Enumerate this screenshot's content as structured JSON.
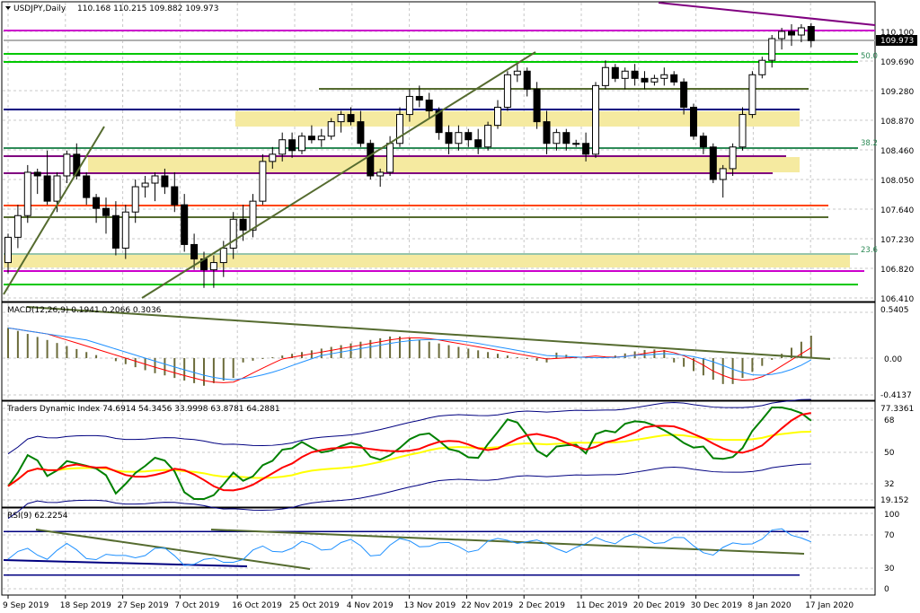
{
  "header": {
    "title": "USDJPY,Daily",
    "ohlc": "110.168 110.215 109.882 109.973"
  },
  "price_panel": {
    "current_price": "109.973",
    "y_ticks": [
      "110.100",
      "109.690",
      "109.280",
      "108.870",
      "108.460",
      "108.050",
      "107.640",
      "107.230",
      "106.820",
      "106.410"
    ],
    "fib_labels": [
      "50.0",
      "38.2",
      "23.6"
    ]
  },
  "macd_panel": {
    "label": "MACD(12,26,9) 0.1941 0.2066 0.3036",
    "y_ticks": [
      "0.5405",
      "0.00",
      "-0.4137"
    ]
  },
  "tdi_panel": {
    "label": "Traders Dynamic Index 74.6914 54.3456 33.9998 63.8781 64.2881",
    "y_ticks": [
      "77.3361",
      "68",
      "50",
      "32",
      "19.152"
    ]
  },
  "rsi_panel": {
    "label": "RSI(9) 62.2254",
    "y_ticks": [
      "100",
      "70",
      "30",
      "0"
    ]
  },
  "x_axis": {
    "labels": [
      "9 Sep 2019",
      "18 Sep 2019",
      "27 Sep 2019",
      "7 Oct 2019",
      "16 Oct 2019",
      "25 Oct 2019",
      "4 Nov 2019",
      "13 Nov 2019",
      "22 Nov 2019",
      "2 Dec 2019",
      "11 Dec 2019",
      "20 Dec 2019",
      "30 Dec 2019",
      "8 Jan 2020",
      "17 Jan 2020"
    ]
  },
  "colors": {
    "bull": "#ffffff",
    "bear": "#000000",
    "support_green": "#00c800",
    "magenta": "#cc00cc",
    "navy": "#000080",
    "purple": "#800080",
    "olive": "#556b2f",
    "orange_red": "#ff4500",
    "zone": "#f5eaa0",
    "macd_signal": "#ff0000",
    "macd_main": "#1e90ff",
    "tdi_green": "#008000",
    "tdi_red": "#ff0000",
    "tdi_yellow": "#ffff00",
    "tdi_band": "#000080",
    "rsi_line": "#1e90ff"
  },
  "chart_data": {
    "type": "candlestick",
    "symbol": "USDJPY",
    "timeframe": "Daily",
    "x_start": "2019-09-09",
    "x_end": "2020-01-21",
    "price_range": [
      106.2,
      110.45
    ],
    "last_close": 109.973,
    "note_values": "OHLC values estimated from chart",
    "candles": [
      [
        106.9,
        107.3,
        106.75,
        107.25
      ],
      [
        107.25,
        107.7,
        107.1,
        107.55
      ],
      [
        107.55,
        108.25,
        107.45,
        108.15
      ],
      [
        108.15,
        108.2,
        107.85,
        108.1
      ],
      [
        108.1,
        108.45,
        107.7,
        107.75
      ],
      [
        107.75,
        108.15,
        107.6,
        108.1
      ],
      [
        108.1,
        108.45,
        108.0,
        108.4
      ],
      [
        108.4,
        108.55,
        108.05,
        108.1
      ],
      [
        108.1,
        108.15,
        107.7,
        107.8
      ],
      [
        107.8,
        107.85,
        107.45,
        107.65
      ],
      [
        107.65,
        107.8,
        107.3,
        107.55
      ],
      [
        107.55,
        107.75,
        107.0,
        107.1
      ],
      [
        107.1,
        107.7,
        106.95,
        107.6
      ],
      [
        107.6,
        108.05,
        107.45,
        107.95
      ],
      [
        107.95,
        108.1,
        107.8,
        108.0
      ],
      [
        108.0,
        108.15,
        107.75,
        108.1
      ],
      [
        108.1,
        108.2,
        107.85,
        107.95
      ],
      [
        107.95,
        108.15,
        107.6,
        107.7
      ],
      [
        107.7,
        107.85,
        107.05,
        107.15
      ],
      [
        107.15,
        107.3,
        106.8,
        106.95
      ],
      [
        106.95,
        107.05,
        106.55,
        106.8
      ],
      [
        106.8,
        107.0,
        106.55,
        106.9
      ],
      [
        106.9,
        107.2,
        106.7,
        107.1
      ],
      [
        107.1,
        107.6,
        106.95,
        107.5
      ],
      [
        107.5,
        107.7,
        107.2,
        107.35
      ],
      [
        107.35,
        107.85,
        107.25,
        107.75
      ],
      [
        107.75,
        108.4,
        107.7,
        108.3
      ],
      [
        108.3,
        108.5,
        108.2,
        108.4
      ],
      [
        108.4,
        108.7,
        108.3,
        108.6
      ],
      [
        108.6,
        108.7,
        108.35,
        108.45
      ],
      [
        108.45,
        108.7,
        108.4,
        108.65
      ],
      [
        108.65,
        108.8,
        108.55,
        108.6
      ],
      [
        108.6,
        108.75,
        108.5,
        108.65
      ],
      [
        108.65,
        108.9,
        108.6,
        108.85
      ],
      [
        108.85,
        109.0,
        108.7,
        108.95
      ],
      [
        108.95,
        109.05,
        108.8,
        108.85
      ],
      [
        108.85,
        109.0,
        108.5,
        108.55
      ],
      [
        108.55,
        108.6,
        108.05,
        108.1
      ],
      [
        108.1,
        108.2,
        107.95,
        108.15
      ],
      [
        108.15,
        108.65,
        108.1,
        108.55
      ],
      [
        108.55,
        109.05,
        108.5,
        108.95
      ],
      [
        108.95,
        109.3,
        108.85,
        109.2
      ],
      [
        109.2,
        109.35,
        109.05,
        109.15
      ],
      [
        109.15,
        109.25,
        108.9,
        109.0
      ],
      [
        109.0,
        109.05,
        108.6,
        108.7
      ],
      [
        108.7,
        108.8,
        108.4,
        108.55
      ],
      [
        108.55,
        108.8,
        108.45,
        108.7
      ],
      [
        108.7,
        108.75,
        108.5,
        108.6
      ],
      [
        108.6,
        108.75,
        108.4,
        108.5
      ],
      [
        108.5,
        108.85,
        108.45,
        108.8
      ],
      [
        108.8,
        109.15,
        108.75,
        109.05
      ],
      [
        109.05,
        109.55,
        109.0,
        109.5
      ],
      [
        109.5,
        109.65,
        109.4,
        109.55
      ],
      [
        109.55,
        109.6,
        109.2,
        109.3
      ],
      [
        109.3,
        109.4,
        108.75,
        108.85
      ],
      [
        108.85,
        109.0,
        108.4,
        108.55
      ],
      [
        108.55,
        108.75,
        108.45,
        108.7
      ],
      [
        108.7,
        108.75,
        108.45,
        108.55
      ],
      [
        108.55,
        108.6,
        108.5,
        108.55
      ],
      [
        108.55,
        108.7,
        108.3,
        108.4
      ],
      [
        108.4,
        109.4,
        108.35,
        109.35
      ],
      [
        109.35,
        109.7,
        109.3,
        109.6
      ],
      [
        109.6,
        109.65,
        109.4,
        109.45
      ],
      [
        109.45,
        109.6,
        109.3,
        109.55
      ],
      [
        109.55,
        109.65,
        109.35,
        109.45
      ],
      [
        109.45,
        109.55,
        109.3,
        109.4
      ],
      [
        109.4,
        109.5,
        109.35,
        109.45
      ],
      [
        109.45,
        109.6,
        109.35,
        109.5
      ],
      [
        109.5,
        109.55,
        109.35,
        109.4
      ],
      [
        109.4,
        109.45,
        108.95,
        109.05
      ],
      [
        109.05,
        109.1,
        108.6,
        108.65
      ],
      [
        108.65,
        108.7,
        108.4,
        108.5
      ],
      [
        108.5,
        108.55,
        108.0,
        108.05
      ],
      [
        108.05,
        108.25,
        107.8,
        108.2
      ],
      [
        108.2,
        108.55,
        108.1,
        108.5
      ],
      [
        108.5,
        109.05,
        108.45,
        108.95
      ],
      [
        108.95,
        109.55,
        108.9,
        109.5
      ],
      [
        109.5,
        109.75,
        109.45,
        109.7
      ],
      [
        109.7,
        110.05,
        109.6,
        110.0
      ],
      [
        110.0,
        110.15,
        109.85,
        110.1
      ],
      [
        110.1,
        110.2,
        109.9,
        110.05
      ],
      [
        110.05,
        110.2,
        109.95,
        110.15
      ],
      [
        110.168,
        110.215,
        109.882,
        109.973
      ]
    ],
    "indicators": {
      "MACD": {
        "params": "12,26,9",
        "values": [
          0.1941,
          0.2066,
          0.3036
        ],
        "range": [
          -0.4137,
          0.5405
        ]
      },
      "TDI": {
        "values": [
          74.6914,
          54.3456,
          33.9998,
          63.8781,
          64.2881
        ],
        "range": [
          19.152,
          77.3361
        ]
      },
      "RSI": {
        "period": 9,
        "value": 62.2254,
        "levels": [
          70,
          30
        ]
      }
    }
  }
}
